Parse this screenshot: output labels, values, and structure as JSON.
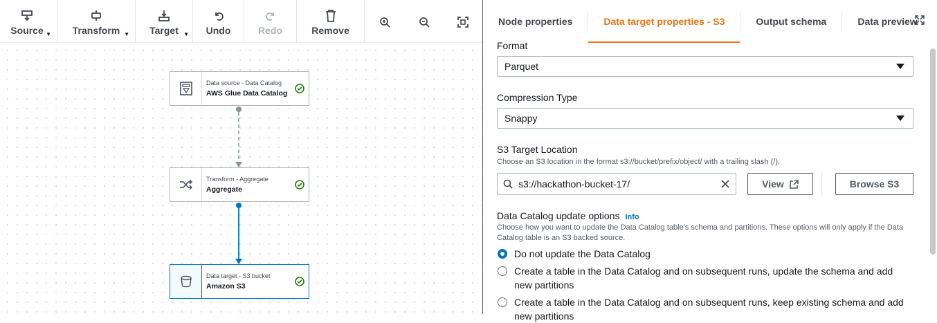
{
  "toolbar": {
    "source_label": "Source",
    "transform_label": "Transform",
    "target_label": "Target",
    "undo_label": "Undo",
    "redo_label": "Redo",
    "remove_label": "Remove"
  },
  "nodes": [
    {
      "subtitle": "Data source - Data Catalog",
      "title": "AWS Glue Data Catalog",
      "icon": "data-catalog-icon",
      "status": "success"
    },
    {
      "subtitle": "Transform - Aggregate",
      "title": "Aggregate",
      "icon": "shuffle-icon",
      "status": "success"
    },
    {
      "subtitle": "Data target - S3 bucket",
      "title": "Amazon S3",
      "icon": "bucket-icon",
      "status": "success"
    }
  ],
  "tabs": [
    {
      "label": "Node properties",
      "active": false
    },
    {
      "label": "Data target properties - S3",
      "active": true
    },
    {
      "label": "Output schema",
      "active": false
    },
    {
      "label": "Data preview",
      "active": false
    }
  ],
  "form": {
    "format_label": "Format",
    "format_value": "Parquet",
    "compression_label": "Compression Type",
    "compression_value": "Snappy",
    "s3_label": "S3 Target Location",
    "s3_desc": "Choose an S3 location in the format s3://bucket/prefix/object/ with a trailing slash (/).",
    "s3_value": "s3://hackathon-bucket-17/",
    "view_label": "View",
    "browse_label": "Browse S3",
    "catalog_label": "Data Catalog update options",
    "info_label": "Info",
    "catalog_desc": "Choose how you want to update the Data Catalog table's schema and partitions. These options will only apply if the Data Catalog table is an S3 backed source.",
    "options": [
      {
        "label": "Do not update the Data Catalog",
        "checked": true
      },
      {
        "label": "Create a table in the Data Catalog and on subsequent runs, update the schema and add new partitions",
        "checked": false
      },
      {
        "label": "Create a table in the Data Catalog and on subsequent runs, keep existing schema and add new partitions",
        "checked": false
      }
    ]
  },
  "colors": {
    "accent_orange": "#ec7211",
    "link_blue": "#0073bb",
    "success_green": "#1d8102"
  }
}
